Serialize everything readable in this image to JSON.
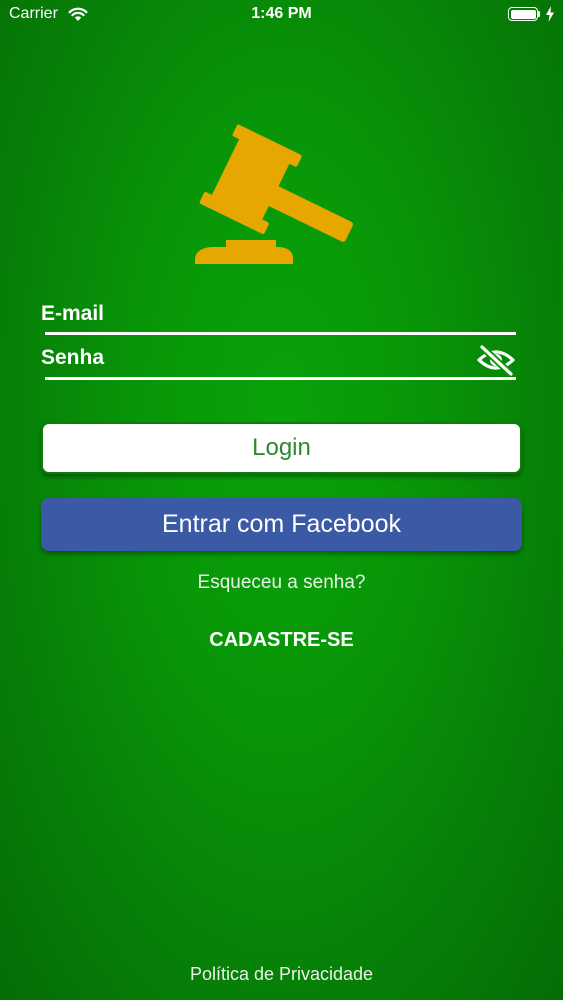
{
  "status_bar": {
    "carrier": "Carrier",
    "time": "1:46 PM",
    "battery_level": 1.0,
    "wifi_icon": "wifi-icon",
    "battery_icon": "battery-icon",
    "charging_icon": "charging-bolt-icon"
  },
  "logo": {
    "icon": "gavel-icon",
    "color": "#e6a800"
  },
  "form": {
    "email_label": "E-mail",
    "password_label": "Senha",
    "password_toggle_icon": "eye-slash-icon"
  },
  "buttons": {
    "login_label": "Login",
    "facebook_label": "Entrar com Facebook"
  },
  "links": {
    "forgot_password": "Esqueceu a senha?",
    "sign_up": "CADASTRE-SE",
    "privacy_policy": "Política de Privacidade"
  },
  "colors": {
    "background": "#089608",
    "login_text": "#2f8a2f",
    "facebook": "#3b5aa6",
    "logo": "#e6a800"
  }
}
